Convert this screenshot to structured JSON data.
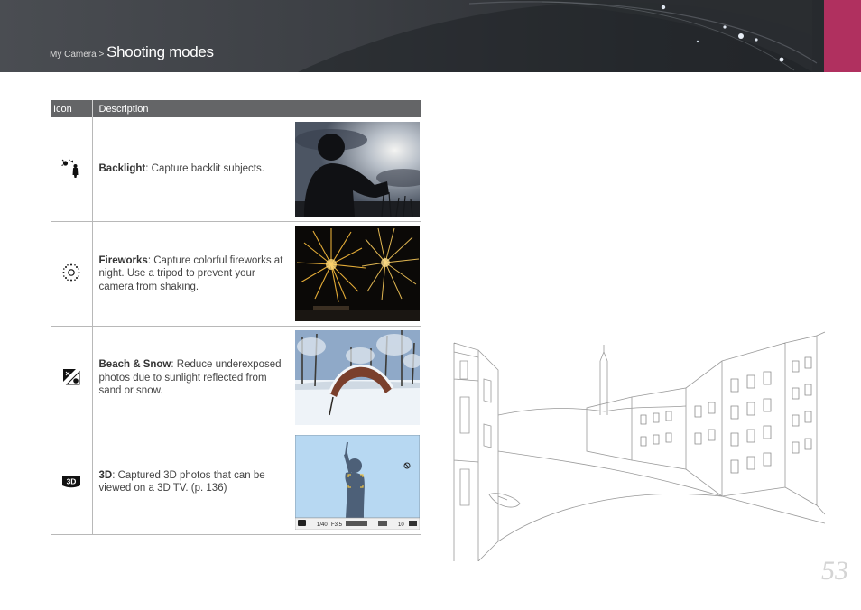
{
  "header": {
    "breadcrumb_parent": "My Camera",
    "breadcrumb_separator": " > ",
    "title": "Shooting modes"
  },
  "table": {
    "columns": [
      "Icon",
      "Description"
    ],
    "rows": [
      {
        "icon": "backlight-icon",
        "name": "Backlight",
        "text": ": Capture backlit subjects."
      },
      {
        "icon": "fireworks-icon",
        "name": "Fireworks",
        "text": ": Capture colorful fireworks at night. Use a tripod to prevent your camera from shaking."
      },
      {
        "icon": "beach-snow-icon",
        "name": "Beach & Snow",
        "text": ": Reduce underexposed photos due to sunlight reflected from sand or snow."
      },
      {
        "icon": "3d-icon",
        "name": "3D",
        "text": ": Captured 3D photos that can be viewed on a 3D TV. (p. 136)"
      }
    ]
  },
  "lcd_preview": {
    "shutter": "1/40",
    "aperture": "F3.5",
    "shots": "10"
  },
  "page_number": "53",
  "colors": {
    "header_dark": "#3c3f44",
    "header_accent": "#b0305f",
    "table_header": "#646567"
  }
}
